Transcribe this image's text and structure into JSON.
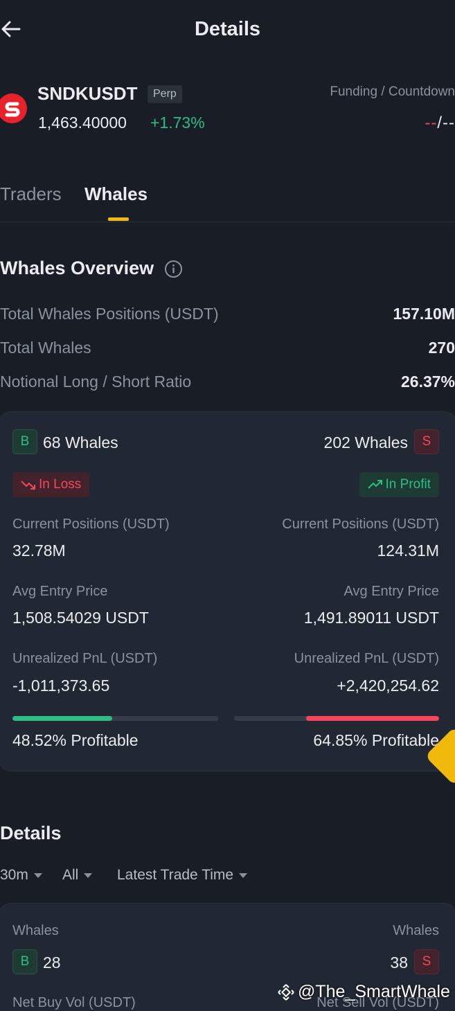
{
  "header": {
    "title": "Details"
  },
  "symbol": {
    "name": "SNDKUSDT",
    "tag": "Perp",
    "price": "1,463.40000",
    "change": "+1.73%",
    "funding_label": "Funding / Countdown",
    "funding_value_left": "--",
    "funding_sep": "/",
    "funding_value_right": "--"
  },
  "tabs": [
    {
      "label": "Traders"
    },
    {
      "label": "Whales"
    }
  ],
  "overview": {
    "title": "Whales Overview",
    "rows": [
      {
        "label": "Total Whales Positions (USDT)",
        "value": "157.10M"
      },
      {
        "label": "Total Whales",
        "value": "270"
      },
      {
        "label": "Notional Long / Short Ratio",
        "value": "26.37%"
      }
    ]
  },
  "summary": {
    "long": {
      "badge": "B",
      "count": "68 Whales",
      "status": "In Loss",
      "pos_label": "Current Positions (USDT)",
      "pos_value": "32.78M",
      "entry_label": "Avg Entry Price",
      "entry_value": "1,508.54029 USDT",
      "pnl_label": "Unrealized PnL (USDT)",
      "pnl_value": "-1,011,373.65",
      "profitable": "48.52% Profitable",
      "profitable_fraction": 0.4852
    },
    "short": {
      "badge": "S",
      "count": "202 Whales",
      "status": "In Profit",
      "pos_label": "Current Positions (USDT)",
      "pos_value": "124.31M",
      "entry_label": "Avg Entry Price",
      "entry_value": "1,491.89011 USDT",
      "pnl_label": "Unrealized PnL (USDT)",
      "pnl_value": "+2,420,254.62",
      "profitable": "64.85% Profitable",
      "profitable_fraction": 0.6485
    }
  },
  "details": {
    "title": "Details",
    "filters": [
      {
        "label": "30m"
      },
      {
        "label": "All"
      },
      {
        "label": "Latest Trade Time"
      }
    ],
    "card": {
      "left_label": "Whales",
      "left_badge": "B",
      "left_count": "28",
      "right_label": "Whales",
      "right_badge": "S",
      "right_count": "38",
      "left_vol_label": "Net Buy Vol (USDT)",
      "right_vol_label": "Net Sell Vol (USDT)"
    }
  },
  "watermark": "@The_SmartWhale",
  "colors": {
    "green": "#2ebd85",
    "red": "#f6465d",
    "accent": "#f0b90b",
    "background": "#181d26",
    "card": "#222833"
  }
}
